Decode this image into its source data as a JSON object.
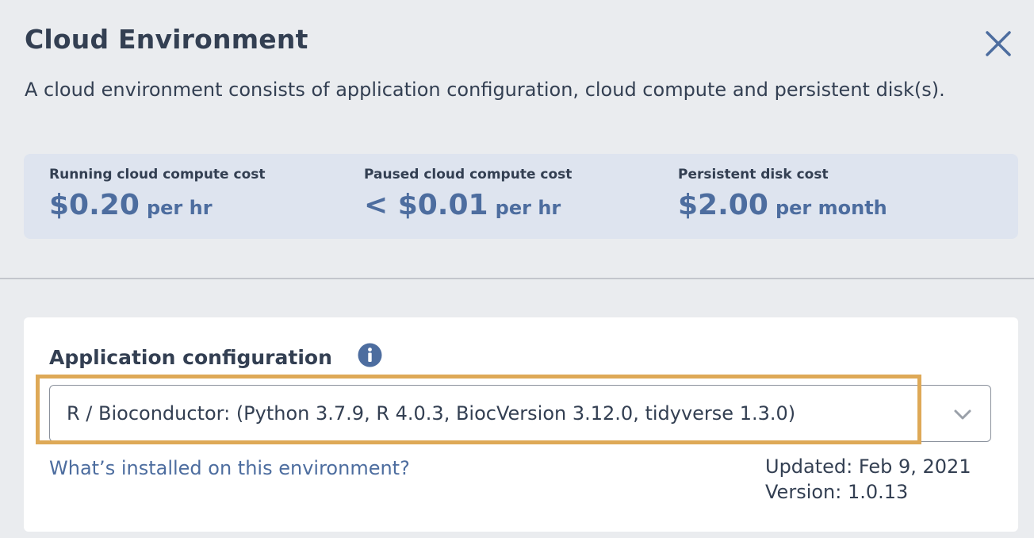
{
  "dialog": {
    "title": "Cloud Environment",
    "description": "A cloud environment consists of application configuration, cloud compute and persistent disk(s).",
    "close_icon": "close-icon"
  },
  "costs": [
    {
      "label": "Running cloud compute cost",
      "amount": "$0.20",
      "unit": "per hr"
    },
    {
      "label": "Paused cloud compute cost",
      "amount": "< $0.01",
      "unit": "per hr"
    },
    {
      "label": "Persistent disk cost",
      "amount": "$2.00",
      "unit": "per month"
    }
  ],
  "app_config": {
    "title": "Application configuration",
    "info_icon": "info-icon",
    "selected_value": "R / Bioconductor: (Python 3.7.9, R 4.0.3, BiocVersion 3.12.0, tidyverse 1.3.0)",
    "chevron_icon": "chevron-down-icon",
    "installed_link": "What’s installed on this environment?",
    "updated": "Updated: Feb 9, 2021",
    "version": "Version: 1.0.13"
  },
  "colors": {
    "title_text": "#333f52",
    "accent": "#4d6d9f",
    "cost_box_bg": "#dee4ef",
    "highlight": "#dea957"
  }
}
